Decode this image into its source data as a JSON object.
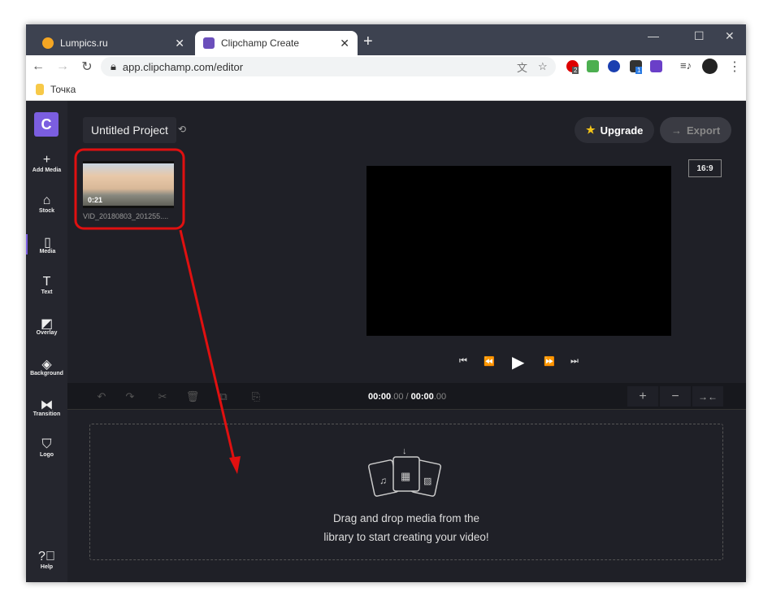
{
  "browser": {
    "tabs": [
      {
        "label": "Lumpics.ru",
        "active": false
      },
      {
        "label": "Clipchamp Create",
        "active": true
      }
    ],
    "url": "app.clipchamp.com/editor",
    "bookmark": "Точка",
    "extension_badges": [
      "2",
      "1"
    ]
  },
  "app": {
    "logo": "C",
    "project_title": "Untitled Project",
    "upgrade": "Upgrade",
    "export": "Export",
    "aspect_ratio": "16:9",
    "sidebar": [
      {
        "label": "Add Media",
        "icon": "plus-icon"
      },
      {
        "label": "Stock",
        "icon": "stock-icon"
      },
      {
        "label": "Media",
        "icon": "file-icon"
      },
      {
        "label": "Text",
        "icon": "text-icon"
      },
      {
        "label": "Overlay",
        "icon": "overlay-icon"
      },
      {
        "label": "Background",
        "icon": "layers-icon"
      },
      {
        "label": "Transition",
        "icon": "transition-icon"
      },
      {
        "label": "Logo",
        "icon": "shield-icon"
      }
    ],
    "help": "Help",
    "media": [
      {
        "duration": "0:21",
        "name": "VID_20180803_201255...."
      }
    ],
    "timeline": {
      "current": "00:00",
      "current_ms": ".00",
      "separator": "/",
      "total": "00:00",
      "total_ms": ".00"
    },
    "drop_text_line1": "Drag and drop media from the",
    "drop_text_line2": "library to start creating your video!",
    "annotation_color": "#e01010",
    "accent": "#7b5ee0"
  }
}
